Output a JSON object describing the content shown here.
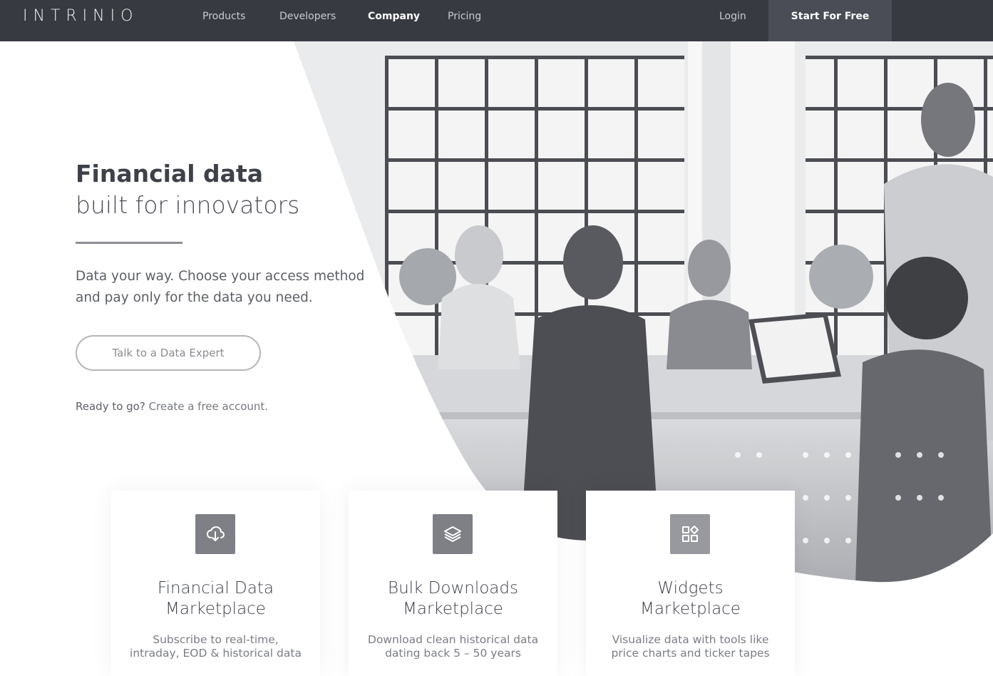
{
  "nav": {
    "logo": "INTRINIO",
    "links": [
      "Products",
      "Developers",
      "Company",
      "Pricing"
    ],
    "login": "Login",
    "cta": "Start For Free"
  },
  "hero": {
    "title_line1": "Financial data",
    "title_line2": "built for innovators",
    "subtitle": "Data your way. Choose your access method and pay only for the data you need.",
    "talk_button": "Talk to a Data Expert",
    "ready_prefix": "Ready to go?",
    "ready_link": "Create a free account."
  },
  "cards": [
    {
      "icon": "cloud-download-icon",
      "title_line1": "Financial Data",
      "title_line2": "Marketplace",
      "desc_line1": "Subscribe to real-time,",
      "desc_line2": "intraday, EOD & historical data"
    },
    {
      "icon": "layers-icon",
      "title_line1": "Bulk Downloads",
      "title_line2": "Marketplace",
      "desc_line1": "Download clean historical data",
      "desc_line2": "dating back 5 – 50 years"
    },
    {
      "icon": "widgets-grid-icon",
      "title_line1": "Widgets",
      "title_line2": "Marketplace",
      "desc_line1": "Visualize data with tools like",
      "desc_line2": "price charts and ticker tapes"
    }
  ],
  "colors": {
    "nav_bg": "#383a42",
    "nav_cta_bg": "#4a4d55",
    "icon_bg": "#7e8086",
    "text_dark": "#3e4149"
  }
}
